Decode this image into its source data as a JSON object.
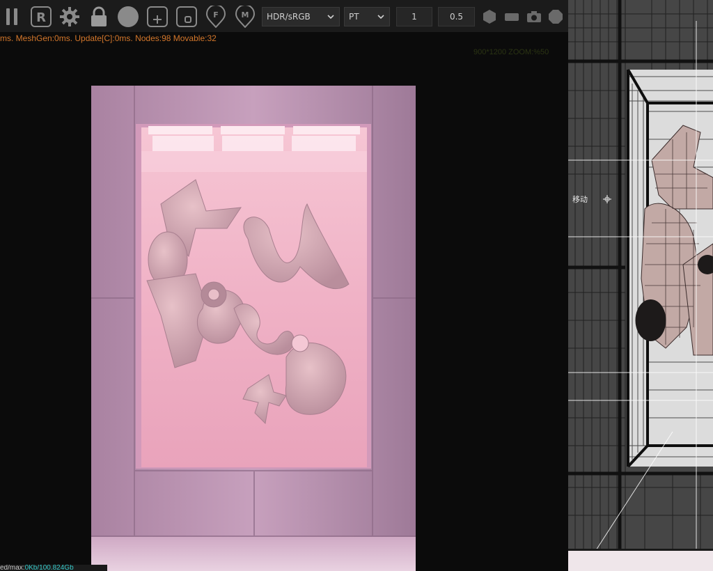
{
  "toolbar": {
    "icons": [
      "pause-icon",
      "reset-icon",
      "settings-gear-icon",
      "lock-icon",
      "sphere-material-icon",
      "add-object-icon",
      "add-plane-icon",
      "focus-marker-icon",
      "measure-marker-icon"
    ],
    "color_mode": "HDR/sRGB",
    "render_mode": "PT",
    "value_a": "1",
    "value_b": "0.5",
    "right_icons": [
      "hexagon-icon",
      "aspect-ratio-icon",
      "camera-icon",
      "octagon-icon"
    ]
  },
  "stats": {
    "text": "ms. MeshGen:0ms. Update[C]:0ms. Nodes:98 Movable:32"
  },
  "viewport": {
    "overlay_text": "900*1200 ZOOM:%50"
  },
  "wireframe": {
    "move_label": "移动"
  },
  "footer": {
    "memory_label": "ed/max:",
    "memory_value": "0Kb/100.824Gb"
  },
  "colors": {
    "toolbar_bg": "#1b1b1b",
    "stats_text": "#d4772b",
    "memory_value": "#35c9c9",
    "scene_pink": "#f1b8c9"
  }
}
